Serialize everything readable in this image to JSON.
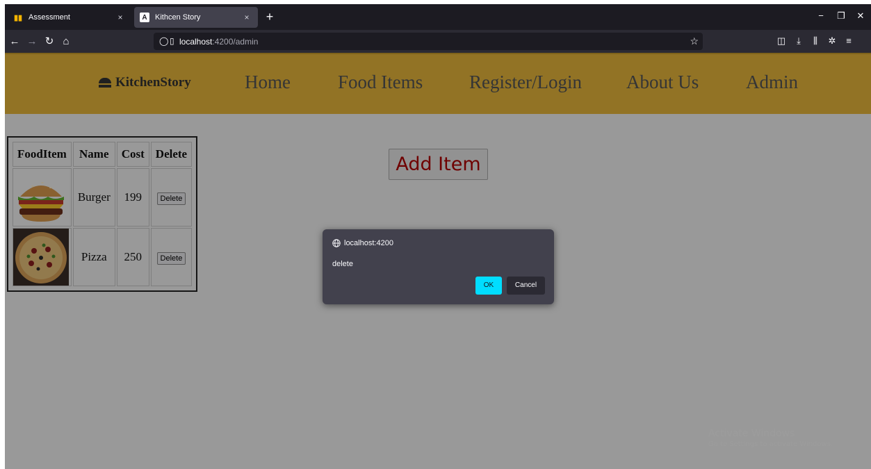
{
  "browser": {
    "tabs": [
      {
        "title": "Assessment",
        "favicon": "assessment-icon",
        "close": "×"
      },
      {
        "title": "Kithcen Story",
        "favicon": "angular-icon",
        "close": "×"
      }
    ],
    "new_tab": "+",
    "window_controls": {
      "minimize": "−",
      "restore": "❐",
      "close": "✕"
    },
    "nav": {
      "back": "←",
      "forward": "→",
      "reload": "↻",
      "home": "⌂"
    },
    "url": {
      "host": "localhost",
      "path": ":4200/admin"
    },
    "bookmark_star": "☆",
    "toolbar": {
      "pocket": "◫",
      "downloads": "⤓",
      "library": "⫼",
      "extensions": "✲",
      "menu": "≡"
    }
  },
  "site": {
    "brand": "KitchenStory",
    "nav": [
      "Home",
      "Food Items",
      "Register/Login",
      "About Us",
      "Admin"
    ],
    "colors": {
      "header": "#e7b73b",
      "add_item_text": "#b00000"
    }
  },
  "table": {
    "headers": [
      "FoodItem",
      "Name",
      "Cost",
      "Delete"
    ],
    "rows": [
      {
        "image": "burger-image",
        "name": "Burger",
        "cost": "199",
        "action": "Delete"
      },
      {
        "image": "pizza-image",
        "name": "Pizza",
        "cost": "250",
        "action": "Delete"
      }
    ]
  },
  "add_item": "Add Item",
  "dialog": {
    "origin": "localhost:4200",
    "message": "delete",
    "ok": "OK",
    "cancel": "Cancel",
    "colors": {
      "ok": "#00ddff"
    }
  },
  "watermark": {
    "line1": "Activate Windows",
    "line2": "Go to Settings to activate Windows."
  }
}
